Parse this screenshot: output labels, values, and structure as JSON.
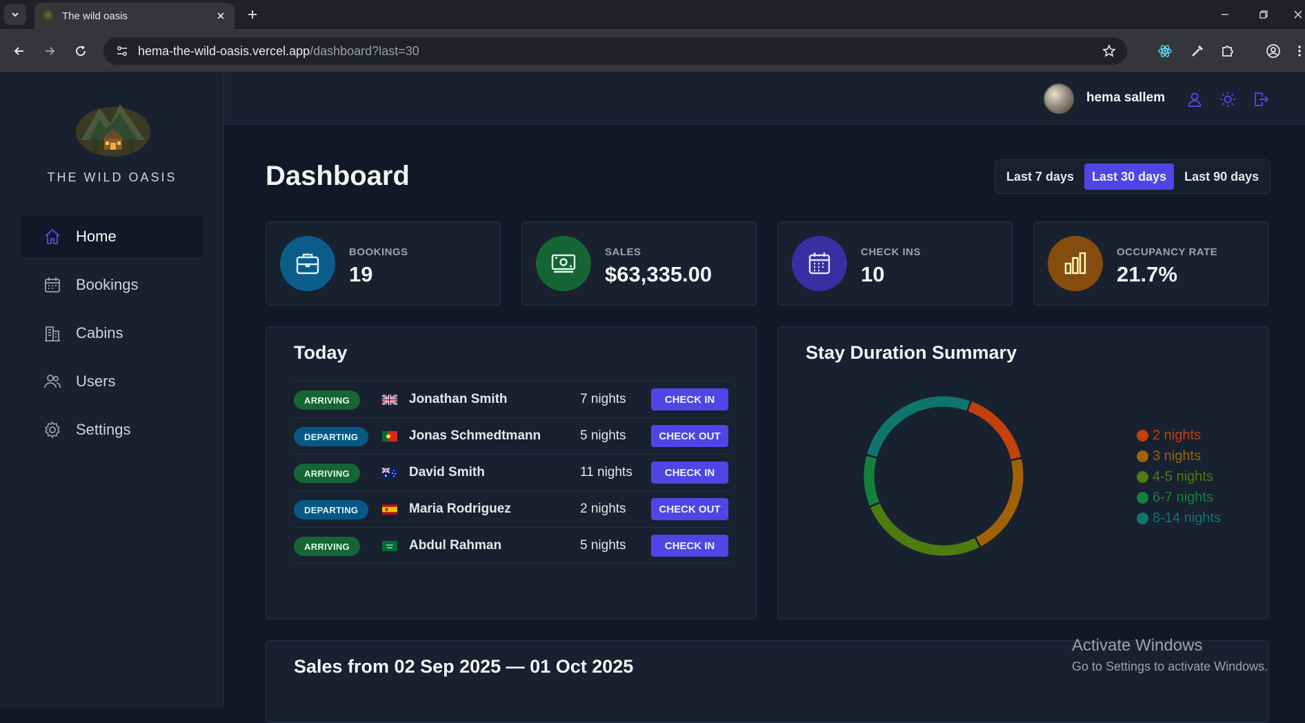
{
  "browser": {
    "tab_title": "The wild oasis",
    "url_host": "hema-the-wild-oasis.vercel.app",
    "url_path": "/dashboard?last=30"
  },
  "sidebar": {
    "brand": "THE WILD OASIS",
    "items": [
      {
        "label": "Home",
        "icon": "home-icon"
      },
      {
        "label": "Bookings",
        "icon": "calendar-icon"
      },
      {
        "label": "Cabins",
        "icon": "buildings-icon"
      },
      {
        "label": "Users",
        "icon": "users-icon"
      },
      {
        "label": "Settings",
        "icon": "gear-icon"
      }
    ]
  },
  "header": {
    "username": "hema sallem"
  },
  "dashboard": {
    "title": "Dashboard",
    "filters": [
      "Last 7 days",
      "Last 30 days",
      "Last 90 days"
    ],
    "active_filter": "Last 30 days",
    "stats": [
      {
        "label": "BOOKINGS",
        "value": "19",
        "icon": "briefcase-icon",
        "color": "#0c5d8c"
      },
      {
        "label": "SALES",
        "value": "$63,335.00",
        "icon": "banknotes-icon",
        "color": "#166534"
      },
      {
        "label": "CHECK INS",
        "value": "10",
        "icon": "calendar-days-icon",
        "color": "#3730a3"
      },
      {
        "label": "OCCUPANCY RATE",
        "value": "21.7%",
        "icon": "chart-bar-icon",
        "color": "#854d0e"
      }
    ],
    "today": {
      "title": "Today",
      "rows": [
        {
          "status": "ARRIVING",
          "flag": "gb",
          "name": "Jonathan Smith",
          "nights": "7 nights",
          "action": "CHECK IN"
        },
        {
          "status": "DEPARTING",
          "flag": "pt",
          "name": "Jonas Schmedtmann",
          "nights": "5 nights",
          "action": "CHECK OUT"
        },
        {
          "status": "ARRIVING",
          "flag": "au",
          "name": "David Smith",
          "nights": "11 nights",
          "action": "CHECK IN"
        },
        {
          "status": "DEPARTING",
          "flag": "es",
          "name": "Maria Rodriguez",
          "nights": "2 nights",
          "action": "CHECK OUT"
        },
        {
          "status": "ARRIVING",
          "flag": "sa",
          "name": "Abdul Rahman",
          "nights": "5 nights",
          "action": "CHECK IN"
        }
      ]
    },
    "stay_duration": {
      "title": "Stay Duration Summary"
    },
    "sales": {
      "title": "Sales from 02 Sep 2025 — 01 Oct 2025"
    }
  },
  "chart_data": {
    "type": "pie",
    "title": "Stay Duration Summary",
    "categories": [
      "2 nights",
      "3 nights",
      "4-5 nights",
      "6-7 nights",
      "8-14 nights"
    ],
    "values": [
      3,
      4,
      5,
      2,
      5
    ],
    "colors": [
      "#c2410c",
      "#a16207",
      "#4d7c0f",
      "#15803d",
      "#0f766e"
    ],
    "donut": true,
    "legend": "right"
  },
  "watermark": {
    "line1": "Activate Windows",
    "line2": "Go to Settings to activate Windows."
  }
}
